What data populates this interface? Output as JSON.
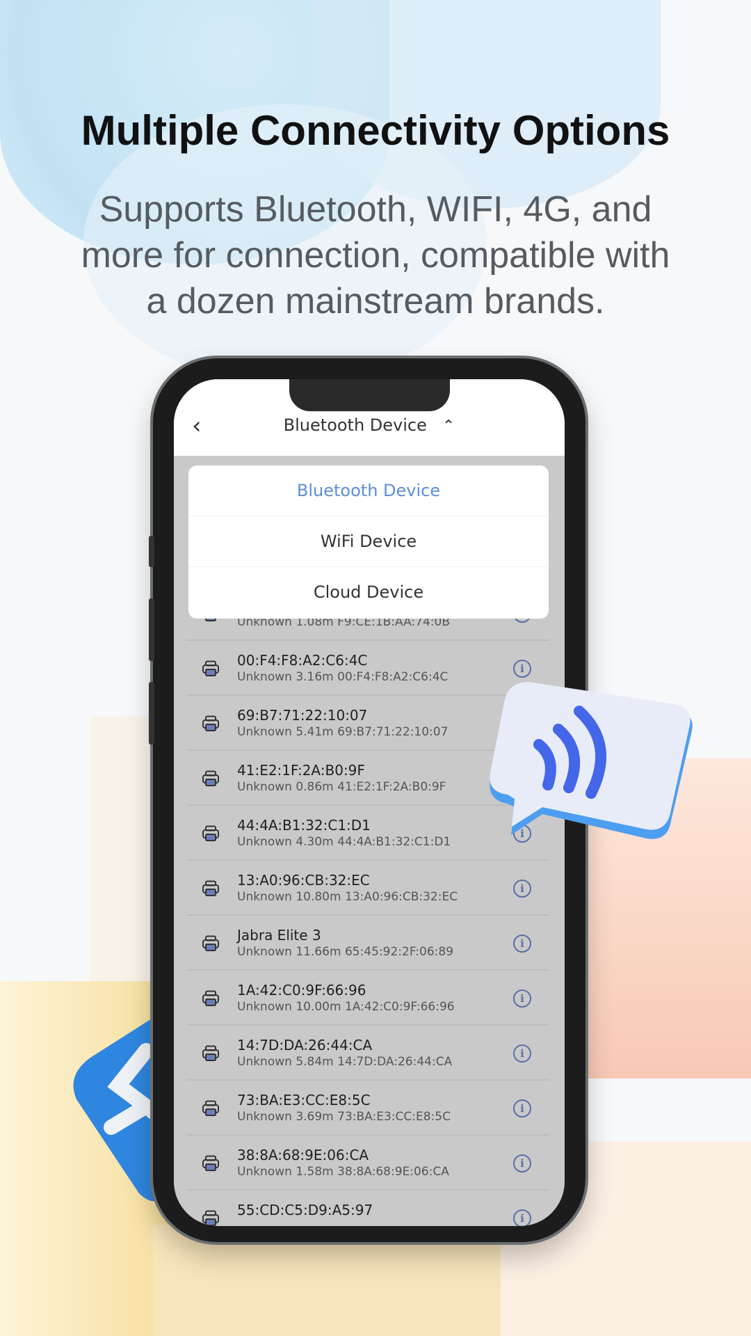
{
  "headline": "Multiple Connectivity Options",
  "subtitle_lines": [
    "Supports Bluetooth, WIFI, 4G, and",
    "more for connection, compatible with",
    "a dozen mainstream brands."
  ],
  "app": {
    "back_icon": "chevron-left-icon",
    "title": "Bluetooth Device",
    "title_chevron": "chevron-up-icon",
    "dropdown": [
      {
        "label": "Bluetooth Device",
        "selected": true
      },
      {
        "label": "WiFi Device",
        "selected": false
      },
      {
        "label": "Cloud Device",
        "selected": false
      }
    ],
    "accent_color": "#5b8fd8",
    "devices": [
      {
        "name": "",
        "meta": "Unknown 1.08m F9:CE:1B:AA:74:0B"
      },
      {
        "name": "00:F4:F8:A2:C6:4C",
        "meta": "Unknown 3.16m 00:F4:F8:A2:C6:4C"
      },
      {
        "name": "69:B7:71:22:10:07",
        "meta": "Unknown 5.41m 69:B7:71:22:10:07"
      },
      {
        "name": "41:E2:1F:2A:B0:9F",
        "meta": "Unknown 0.86m 41:E2:1F:2A:B0:9F"
      },
      {
        "name": "44:4A:B1:32:C1:D1",
        "meta": "Unknown 4.30m 44:4A:B1:32:C1:D1"
      },
      {
        "name": "13:A0:96:CB:32:EC",
        "meta": "Unknown 10.80m 13:A0:96:CB:32:EC"
      },
      {
        "name": "Jabra Elite 3",
        "meta": "Unknown 11.66m 65:45:92:2F:06:89"
      },
      {
        "name": "1A:42:C0:9F:66:96",
        "meta": "Unknown 10.00m 1A:42:C0:9F:66:96"
      },
      {
        "name": "14:7D:DA:26:44:CA",
        "meta": "Unknown 5.84m 14:7D:DA:26:44:CA"
      },
      {
        "name": "73:BA:E3:CC:E8:5C",
        "meta": "Unknown 3.69m 73:BA:E3:CC:E8:5C"
      },
      {
        "name": "38:8A:68:9E:06:CA",
        "meta": "Unknown 1.58m 38:8A:68:9E:06:CA"
      },
      {
        "name": "55:CD:C5:D9:A5:97",
        "meta": ""
      }
    ]
  },
  "decor": {
    "wifi_bubble": "wifi-signal-bubble-icon",
    "bluetooth_badge": "bluetooth-icon"
  }
}
